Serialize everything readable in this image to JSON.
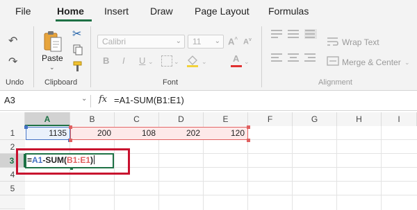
{
  "tabs": [
    {
      "label": "File",
      "active": false
    },
    {
      "label": "Home",
      "active": true
    },
    {
      "label": "Insert",
      "active": false
    },
    {
      "label": "Draw",
      "active": false
    },
    {
      "label": "Page Layout",
      "active": false
    },
    {
      "label": "Formulas",
      "active": false
    }
  ],
  "accent_color": "#1e7145",
  "ribbon": {
    "undo_label": "Undo",
    "clipboard": {
      "paste_label": "Paste",
      "group_label": "Clipboard"
    },
    "font": {
      "name_value": "Calibri",
      "size_value": "11",
      "group_label": "Font"
    },
    "alignment": {
      "wrap_text_label": "Wrap Text",
      "merge_center_label": "Merge & Center",
      "group_label": "Alignment"
    }
  },
  "formula_bar": {
    "name_box": "A3",
    "fx_label": "fx",
    "formula": "=A1-SUM(B1:E1)"
  },
  "grid": {
    "columns": [
      "A",
      "B",
      "C",
      "D",
      "E",
      "F",
      "G",
      "H",
      "I"
    ],
    "selected_column": "A",
    "rows": [
      "1",
      "2",
      "3",
      "4",
      "5"
    ],
    "selected_row": "3",
    "row1_values": {
      "A": "1135",
      "B": "200",
      "C": "108",
      "D": "202",
      "E": "120"
    },
    "editing_cell": {
      "ref": "A3",
      "parts": [
        {
          "text": "=",
          "color": "#222222"
        },
        {
          "text": "A1",
          "color": "#4472c4"
        },
        {
          "text": "-SUM(",
          "color": "#222222"
        },
        {
          "text": "B1:E1",
          "color": "#e06060"
        },
        {
          "text": ")",
          "color": "#222222"
        }
      ]
    },
    "reference_colors": {
      "a1": "#4472c4",
      "range": "#e06060"
    },
    "highlight_color": "#c8102e"
  }
}
